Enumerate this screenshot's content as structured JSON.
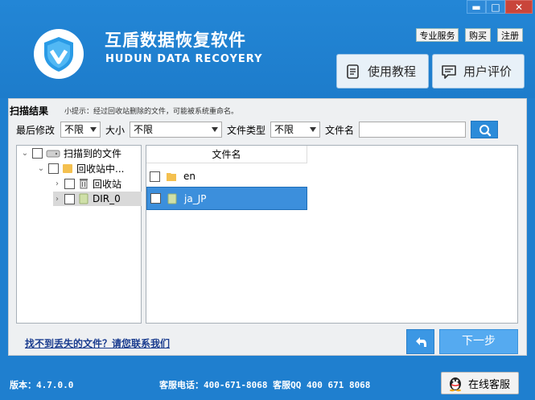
{
  "window": {
    "min": "▬",
    "max": "□",
    "close": "✕"
  },
  "header": {
    "title_cn": "互盾数据恢复软件",
    "title_en": "HUDUN DATA RECOYERY",
    "links": {
      "service": "专业服务",
      "buy": "购买",
      "register": "注册"
    },
    "tutorial_label": "使用教程",
    "review_label": "用户评价"
  },
  "scan": {
    "title": "扫描结果",
    "tip": "小提示：经过回收站删除的文件，可能被系统重命名。"
  },
  "filters": {
    "modified_label": "最后修改",
    "modified_value": "不限",
    "size_label": "大小",
    "size_value": "不限",
    "type_label": "文件类型",
    "type_value": "不限",
    "name_label": "文件名",
    "name_value": ""
  },
  "tree": {
    "root": "扫描到的文件",
    "recycle_parent": "回收站中...",
    "recycle_bin": "回收站",
    "dir0": "DIR_0"
  },
  "filelist": {
    "column": "文件名",
    "rows": [
      {
        "name": "en"
      },
      {
        "name": "ja_JP"
      }
    ]
  },
  "bottom": {
    "help_link": "找不到丢失的文件？请您联系我们",
    "next_label": "下一步"
  },
  "footer": {
    "version": "版本：4.7.0.0",
    "phone": "客服电话：400-671-8068 客服QQ 400 671 8068",
    "online_label": "在线客服"
  },
  "colors": {
    "brand": "#1f7fcf",
    "selected_row": "#3c8fdc",
    "next_button": "#55aaf0"
  }
}
